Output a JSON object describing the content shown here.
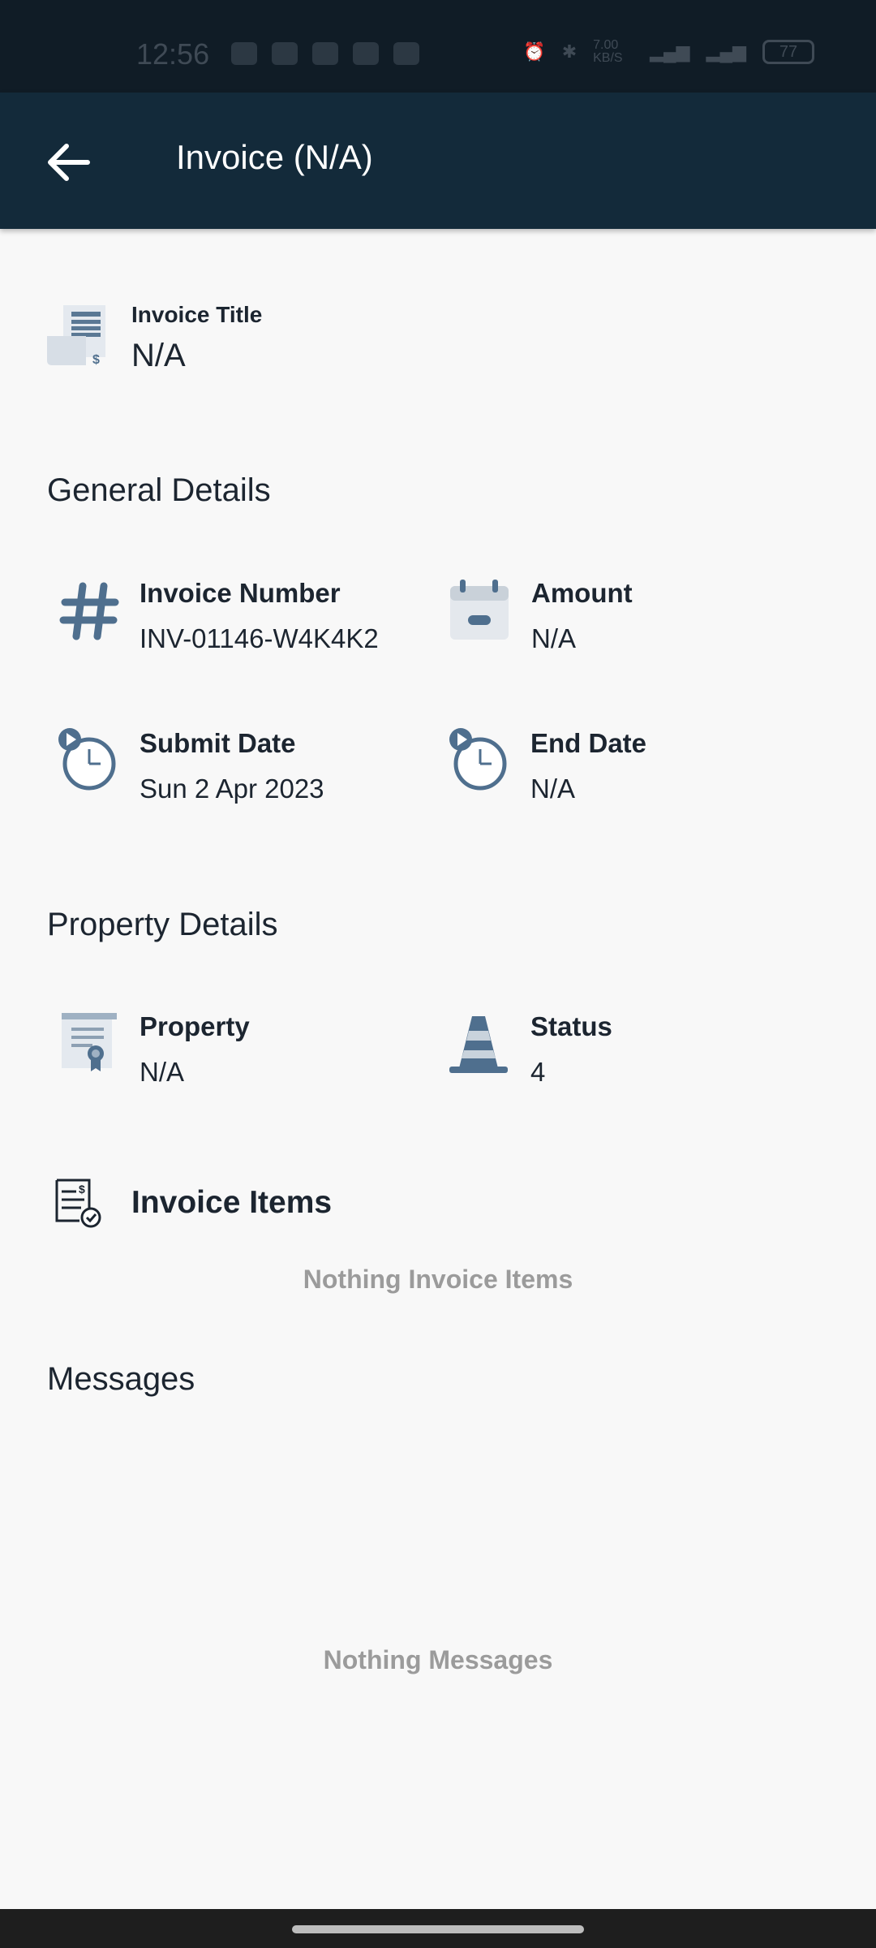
{
  "status_bar": {
    "time": "12:56",
    "battery": "77",
    "net_speed": "7.00 KB/S"
  },
  "app_bar": {
    "title": "Invoice (N/A)"
  },
  "invoice_title": {
    "label": "Invoice Title",
    "value": "N/A"
  },
  "general": {
    "heading": "General Details",
    "invoice_number": {
      "label": "Invoice Number",
      "value": "INV-01146-W4K4K2"
    },
    "amount": {
      "label": "Amount",
      "value": "N/A"
    },
    "submit_date": {
      "label": "Submit Date",
      "value": "Sun 2 Apr 2023"
    },
    "end_date": {
      "label": "End Date",
      "value": "N/A"
    }
  },
  "property": {
    "heading": "Property Details",
    "property": {
      "label": "Property",
      "value": "N/A"
    },
    "status": {
      "label": "Status",
      "value": "4"
    }
  },
  "invoice_items": {
    "heading": "Invoice Items",
    "empty_text": "Nothing Invoice Items"
  },
  "messages": {
    "heading": "Messages",
    "empty_text": "Nothing Messages"
  },
  "colors": {
    "app_bar": "#132a3a",
    "icon_blue": "#4f6f8e",
    "background": "#f8f8f8"
  }
}
